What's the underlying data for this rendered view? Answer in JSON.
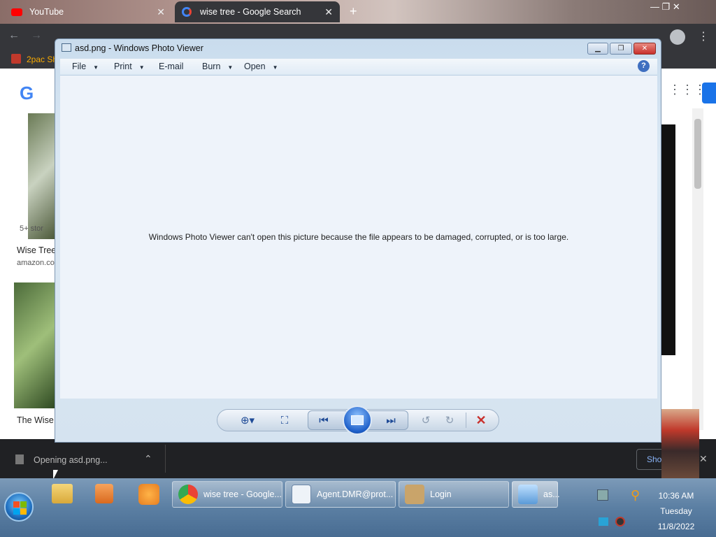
{
  "browser": {
    "tabs": [
      {
        "title": "YouTube"
      },
      {
        "title": "wise tree - Google Search"
      }
    ],
    "new_tab": "+",
    "bookmark": "2pac Sh",
    "page": {
      "result1_tag": "5+ stor",
      "result1_title": "Wise Tree",
      "result1_source": "amazon.co",
      "result2_title": "The Wise"
    },
    "download": {
      "label": "Opening asd.png...",
      "show_all": "Sho"
    }
  },
  "photo_viewer": {
    "title": "asd.png - Windows Photo Viewer",
    "menu": [
      {
        "label": "File"
      },
      {
        "label": "Print"
      },
      {
        "label": "E-mail"
      },
      {
        "label": "Burn"
      },
      {
        "label": "Open"
      }
    ],
    "message": "Windows Photo Viewer can't open this picture because the file appears to be damaged, corrupted, or is too large."
  },
  "taskbar": {
    "windows": [
      {
        "label": "wise tree - Google..."
      },
      {
        "label": "Agent.DMR@prot..."
      },
      {
        "label": "Login"
      },
      {
        "label": "as..."
      }
    ],
    "clock": {
      "time": "10:36 AM",
      "day": "Tuesday",
      "date": "11/8/2022"
    }
  },
  "colors": {
    "accent": "#1e4a96",
    "close_red": "#c9302c",
    "download_text": "#bbbbbb"
  }
}
